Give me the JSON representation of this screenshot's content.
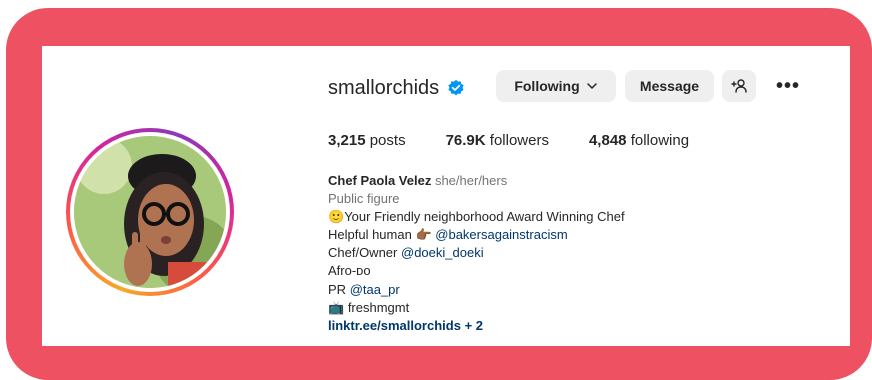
{
  "profile": {
    "username": "smallorchids",
    "following_label": "Following",
    "message_label": "Message",
    "stats": {
      "posts_count": "3,215",
      "posts_label": "posts",
      "followers_count": "76.9K",
      "followers_label": "followers",
      "following_count": "4,848",
      "following_label": "following"
    },
    "bio": {
      "name": "Chef Paola Velez",
      "pronouns": "she/her/hers",
      "category": "Public figure",
      "line1_emoji": "🙂",
      "line1_text": "Your Friendly neighborhood Award Winning Chef",
      "line2_text": "Helpful human",
      "line2_emoji": "👉🏾",
      "line2_mention": "@bakersagainstracism",
      "line3_text": "Chef/Owner",
      "line3_mention": "@doeki_doeki",
      "line4_text": "Afro-ᴅo",
      "line5_text": "PR",
      "line5_mention": "@taa_pr",
      "line6_emoji": "📺",
      "line6_text": "freshmgmt",
      "link_text": "linktr.ee/smallorchids",
      "link_more": "+ 2"
    }
  },
  "colors": {
    "frame": "#ee5162",
    "verified": "#0095f6",
    "link": "#00376b",
    "button_bg": "#efefef"
  },
  "icons": {
    "verified": "verified-badge-icon",
    "chevron": "chevron-down-icon",
    "add_user": "add-user-icon",
    "more": "more-options-icon"
  }
}
